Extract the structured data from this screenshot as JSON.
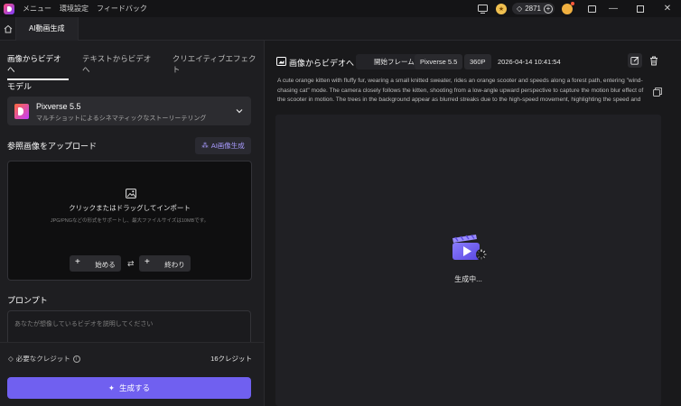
{
  "titlebar": {
    "menu": [
      "メニュー",
      "環境設定",
      "フィードバック"
    ],
    "credits": "2871"
  },
  "tabs": {
    "document": "AI動画生成"
  },
  "left": {
    "mode_tabs": [
      "画像からビデオへ",
      "テキストからビデオへ",
      "クリエイティブエフェクト"
    ],
    "model_label": "モデル",
    "model_name": "Pixverse 5.5",
    "model_desc": "マルチショットによるシネマティックなストーリーテリング",
    "ref_label": "参照画像をアップロード",
    "ai_gen_label": "AI画像生成",
    "upload_title": "クリックまたはドラッグしてインポート",
    "upload_hint": "JPG/PNGなどの形式をサポートし、最大ファイルサイズは10MBです。",
    "start_frame": "始める",
    "end_frame": "終わり",
    "prompt_label": "プロンプト",
    "prompt_placeholder": "あなたが想像しているビデオを説明してください",
    "credit_req_label": "必要なクレジット",
    "credit_amount": "16クレジット",
    "generate_label": "生成する"
  },
  "right": {
    "title": "画像からビデオへ",
    "frame_chip": "開始フレーム",
    "model_chip": "Pixverse 5.5",
    "resolution_chip": "360P",
    "timestamp": "2026-04-14 10:41:54",
    "prompt": "A cute orange kitten with fluffy fur, wearing a small knitted sweater, rides an orange scooter and speeds along a forest path, entering \"wind-chasing cat\" mode. The camera closely follows the kitten, shooting from a low-angle upward perspective to capture the motion blur effect of the scooter in motion. The trees in the background appear as blurred streaks due to the high-speed movement, highlighting the speed and agility of the kitten's ride. Sunlight",
    "status": "生成中..."
  },
  "colors": {
    "accent": "#7060f0",
    "panel": "#1e1e21",
    "upload_bg": "#0f0f10"
  }
}
